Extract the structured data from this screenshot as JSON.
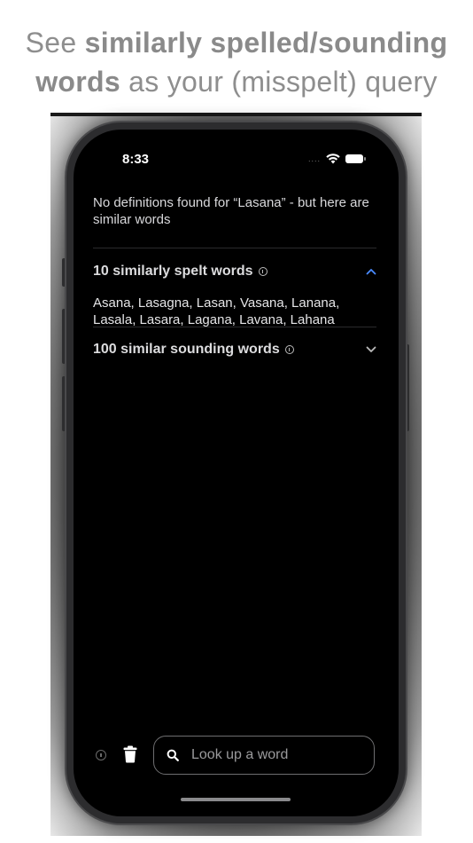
{
  "headline": {
    "line1_plain": "See ",
    "line1_bold": "similarly spelled/sounding",
    "line2_bold": "words",
    "line2_plain": " as your (misspelt) query"
  },
  "status_bar": {
    "time": "8:33",
    "signal": "....",
    "icons": [
      "wifi-icon",
      "battery-icon"
    ]
  },
  "results": {
    "notice": "No definitions found for “Lasana” - but here are similar words",
    "spelt_section": {
      "title": "10 similarly spelt words",
      "expanded": true,
      "words": "Asana, Lasagna, Lasan, Vasana, Lanana, Lasala, Lasara, Lagana, Lavana, Lahana"
    },
    "sounding_section": {
      "title": "100 similar sounding words",
      "expanded": false
    }
  },
  "bottom_bar": {
    "search": {
      "value": "",
      "placeholder": "Look up a word"
    },
    "icons": [
      "info-icon",
      "trash-icon",
      "search-icon"
    ]
  },
  "colors": {
    "accent": "#4a8cff",
    "background": "#000000",
    "text": "#e5e5e7"
  }
}
